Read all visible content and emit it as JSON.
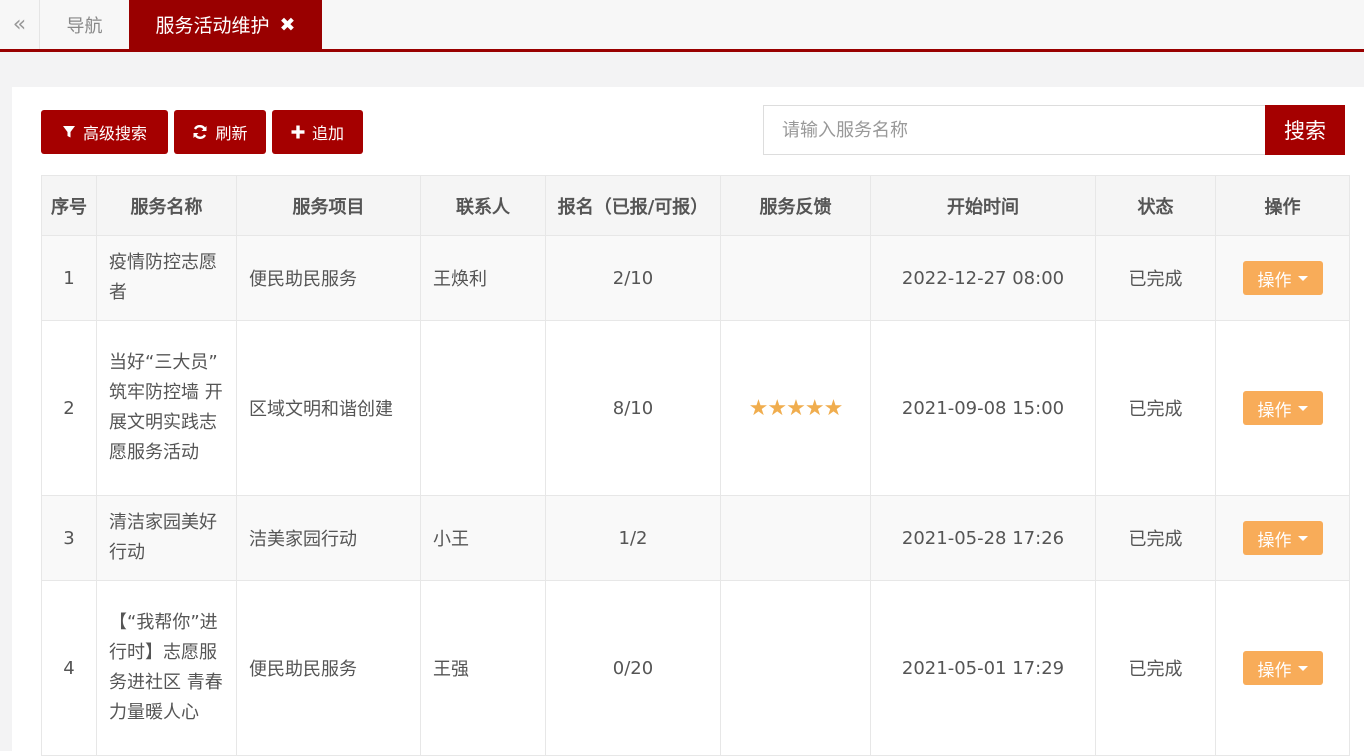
{
  "tabs": {
    "collapse_glyph": "«",
    "nav_label": "导航",
    "active_label": "服务活动维护",
    "close_glyph": "✖"
  },
  "toolbar": {
    "advanced_search": "高级搜索",
    "refresh": "刷新",
    "add": "追加",
    "advanced_icon": "filter-icon",
    "refresh_icon": "refresh-icon",
    "add_icon": "plus-icon"
  },
  "search": {
    "placeholder": "请输入服务名称",
    "button": "搜索"
  },
  "table": {
    "headers": [
      "序号",
      "服务名称",
      "服务项目",
      "联系人",
      "报名（已报/可报）",
      "服务反馈",
      "开始时间",
      "状态",
      "操作"
    ],
    "rows": [
      {
        "no": "1",
        "name": "疫情防控志愿者",
        "project": "便民助民服务",
        "contact": "王焕利",
        "signup": "2/10",
        "feedback_stars": 0,
        "start_time": "2022-12-27 08:00",
        "status": "已完成",
        "action": "操作"
      },
      {
        "no": "2",
        "name": "当好“三大员” 筑牢防控墙 开展文明实践志愿服务活动",
        "project": "区域文明和谐创建",
        "contact": "",
        "signup": "8/10",
        "feedback_stars": 5,
        "start_time": "2021-09-08 15:00",
        "status": "已完成",
        "action": "操作"
      },
      {
        "no": "3",
        "name": "清洁家园美好行动",
        "project": "洁美家园行动",
        "contact": "小王",
        "signup": "1/2",
        "feedback_stars": 0,
        "start_time": "2021-05-28 17:26",
        "status": "已完成",
        "action": "操作"
      },
      {
        "no": "4",
        "name": "【“我帮你”进行时】志愿服务进社区 青春力量暖人心",
        "project": "便民助民服务",
        "contact": "王强",
        "signup": "0/20",
        "feedback_stars": 0,
        "start_time": "2021-05-01 17:29",
        "status": "已完成",
        "action": "操作"
      }
    ]
  },
  "colors": {
    "brand": "#a50000",
    "tab_active": "#990000",
    "action_button": "#f8ac59",
    "star": "#f0ad4e"
  }
}
